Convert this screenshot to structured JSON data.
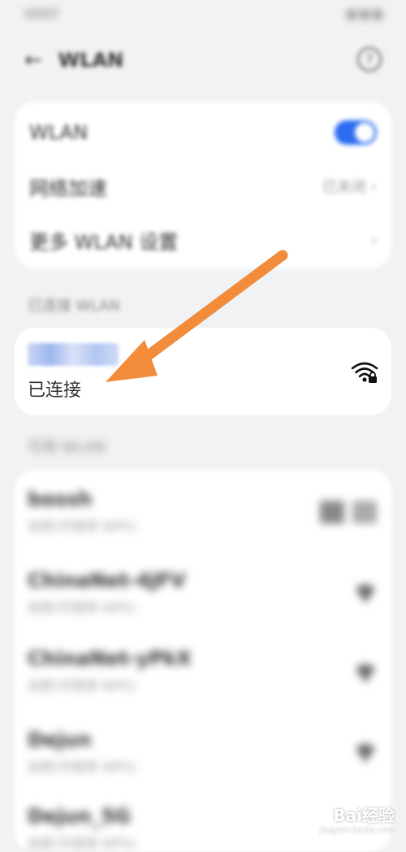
{
  "statusbar": {
    "left": "VIVOT",
    "right": ""
  },
  "appbar": {
    "back_icon": "back-arrow-icon",
    "title": "WLAN",
    "help_icon": "help-icon"
  },
  "settings_card": {
    "wlan_label": "WLAN",
    "wlan_enabled": true,
    "network_boost_label": "网络加速",
    "network_boost_value": "已关闭",
    "more_label": "更多 WLAN 设置"
  },
  "connected_section": {
    "title": "已连接 WLAN",
    "status": "已连接",
    "signal_icon": "wifi-locked-icon"
  },
  "available_section": {
    "title": "可用 WLAN",
    "networks": [
      {
        "name": "bossh",
        "sub": "加密(可使用 WPS)"
      },
      {
        "name": "ChinaNet-4JFV",
        "sub": "加密(可使用 WPS)"
      },
      {
        "name": "ChinaNet-yPkX",
        "sub": "加密(可使用 WPS)"
      },
      {
        "name": "Dejun",
        "sub": "加密(可使用 WPS)"
      },
      {
        "name": "Dejun_5G",
        "sub": "加密(可使用 WPS)"
      }
    ]
  },
  "annotation": {
    "arrow_color": "#f28c3a"
  },
  "watermark": {
    "brand": "Bai经验",
    "url": "jingyan.baidu.com"
  },
  "colors": {
    "accent": "#2b6cf0",
    "background": "#f1f2f4"
  }
}
